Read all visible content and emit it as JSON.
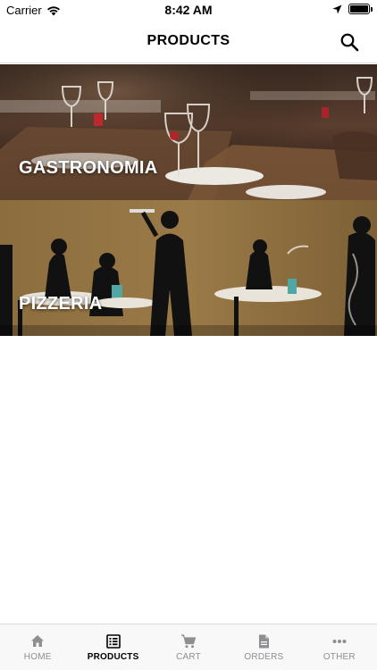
{
  "status_bar": {
    "carrier": "Carrier",
    "time": "8:42 AM",
    "icons": [
      "wifi-icon",
      "location-arrow-icon",
      "battery-icon"
    ]
  },
  "header": {
    "title": "PRODUCTS",
    "search_icon": "search-icon"
  },
  "categories": [
    {
      "label": "GASTRONOMIA",
      "image": "restaurant-tables-with-wine-glasses"
    },
    {
      "label": "PIZZERIA",
      "image": "waiter-and-diners-silhouettes"
    }
  ],
  "tab_bar": {
    "active": "PRODUCTS",
    "tabs": [
      {
        "label": "HOME",
        "icon": "home-icon"
      },
      {
        "label": "PRODUCTS",
        "icon": "list-icon"
      },
      {
        "label": "CART",
        "icon": "cart-icon"
      },
      {
        "label": "ORDERS",
        "icon": "document-icon"
      },
      {
        "label": "OTHER",
        "icon": "more-icon"
      }
    ]
  },
  "colors": {
    "active_tab": "#000000",
    "inactive_tab": "#8e8e93",
    "tab_bar_bg": "#f8f8f8"
  }
}
